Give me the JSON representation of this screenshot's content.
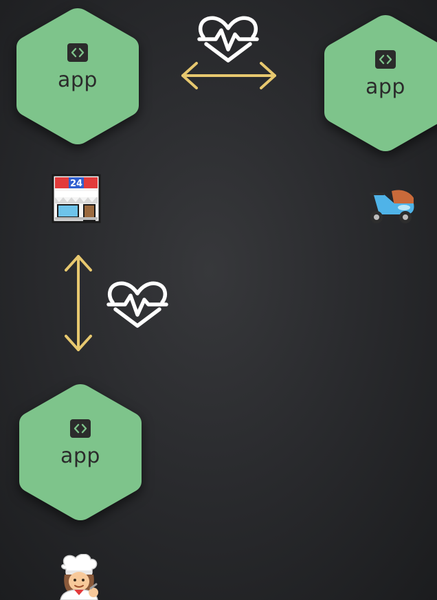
{
  "nodes": [
    {
      "label": "app",
      "icon": "code-icon"
    },
    {
      "label": "app",
      "icon": "code-icon"
    },
    {
      "label": "app",
      "icon": "code-icon"
    }
  ],
  "colors": {
    "node_fill": "#7ec48b",
    "arrow": "#e7c86f",
    "heartbeat": "#ffffff",
    "label": "#2b2b2b"
  },
  "icons": {
    "store": "convenience-store-icon",
    "scooter": "scooter-icon",
    "chef": "cook-icon",
    "health": "heartbeat-icon"
  }
}
